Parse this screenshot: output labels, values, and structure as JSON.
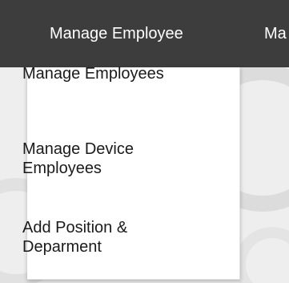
{
  "top_nav": {
    "items": [
      {
        "label": "Manage Employee"
      },
      {
        "label": "Ma"
      }
    ]
  },
  "dropdown": {
    "items": [
      {
        "lines": [
          "Manage Employees"
        ]
      },
      {
        "lines": [
          "Manage Device",
          "Employees"
        ]
      },
      {
        "lines": [
          "Add Position &",
          "Deparment"
        ]
      }
    ]
  },
  "colors": {
    "topbar": "#3d3d3d",
    "background": "#eeeeee",
    "dropdown": "#ffffff",
    "menu_text": "#1a1a1a"
  }
}
